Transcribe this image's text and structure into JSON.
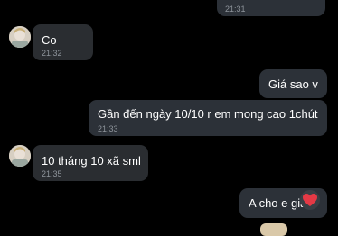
{
  "conversation": {
    "messages": [
      {
        "direction": "outgoing",
        "text": "",
        "time": "21:31"
      },
      {
        "direction": "incoming",
        "text": "Co",
        "time": "21:32"
      },
      {
        "direction": "outgoing",
        "text": "Giá sao v",
        "time": ""
      },
      {
        "direction": "outgoing",
        "text": "Gần đến ngày 10/10 r em mong cao 1chút",
        "time": "21:33"
      },
      {
        "direction": "incoming",
        "text": "10 tháng 10 xã sml",
        "time": "21:35"
      },
      {
        "direction": "outgoing",
        "text": "A cho e giá",
        "time": ""
      }
    ],
    "reaction": {
      "icon": "heart-icon",
      "color": "#e53945"
    }
  },
  "colors": {
    "background": "#000000",
    "bubble": "#2c3138",
    "text": "#ffffff",
    "timestamp": "#8e949b"
  }
}
